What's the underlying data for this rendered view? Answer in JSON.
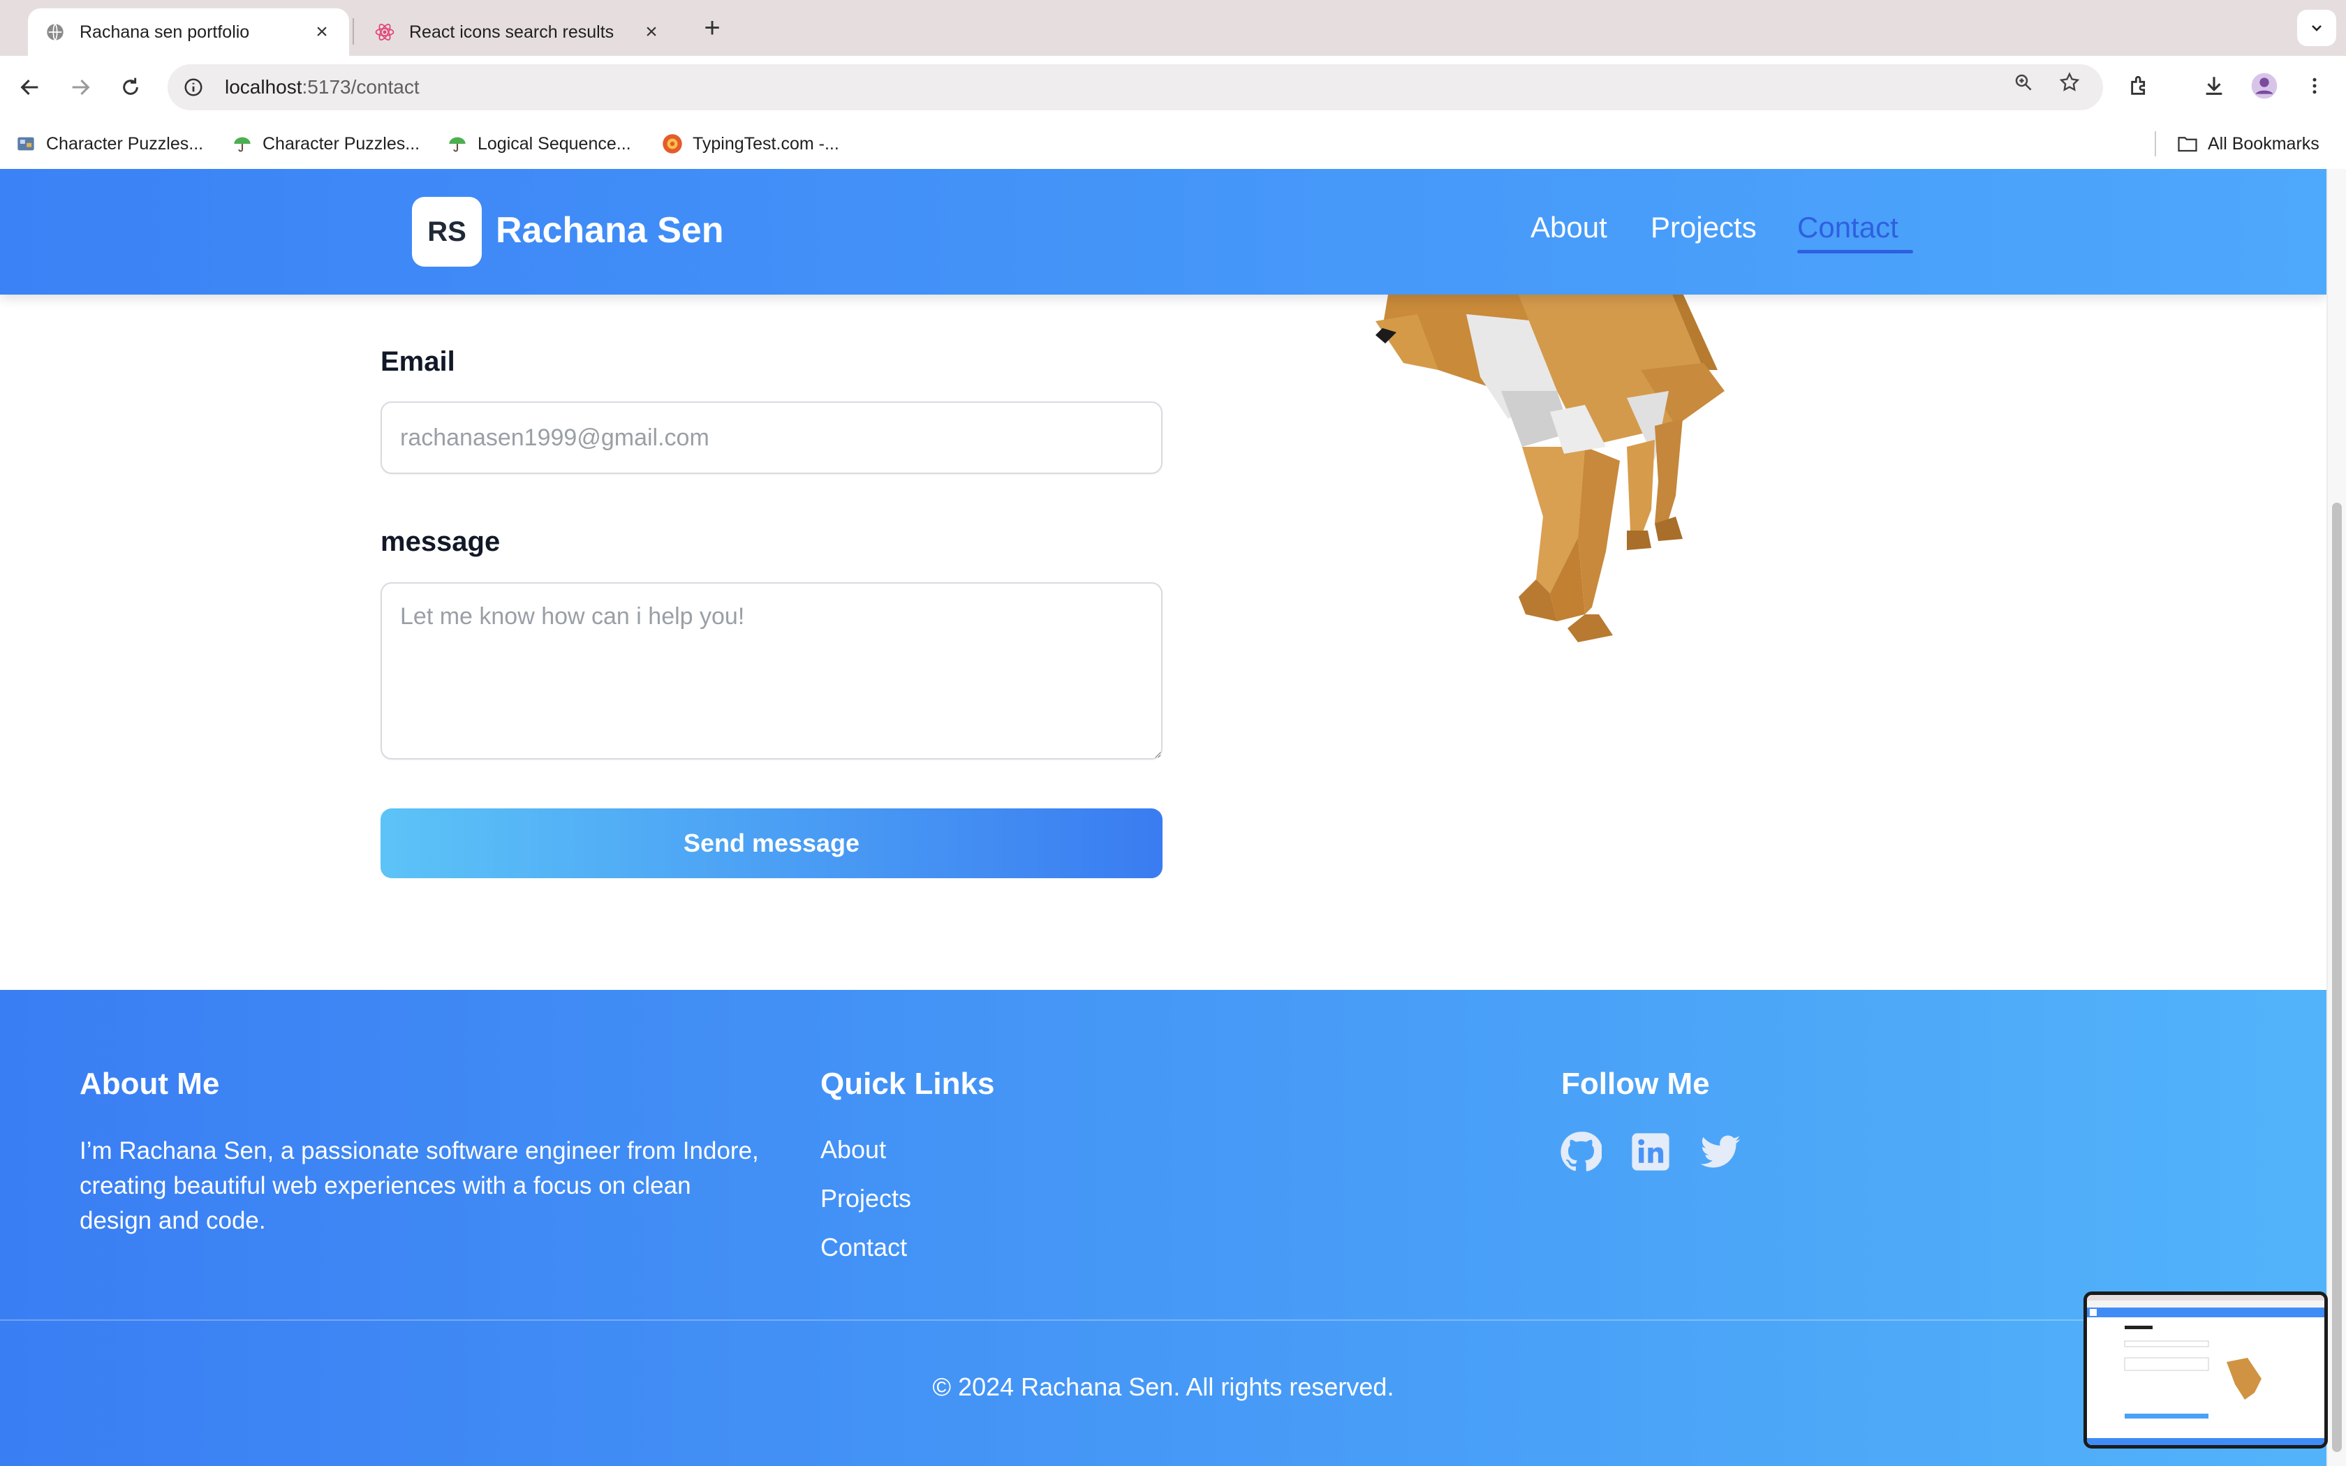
{
  "browser": {
    "tabs": [
      {
        "title": "Rachana sen portfolio",
        "active": true
      },
      {
        "title": "React icons search results",
        "active": false
      }
    ],
    "url_host": "localhost",
    "url_path": ":5173/contact",
    "bookmarks": [
      {
        "label": "Character Puzzles..."
      },
      {
        "label": "Character Puzzles..."
      },
      {
        "label": "Logical Sequence..."
      },
      {
        "label": "TypingTest.com -..."
      }
    ],
    "all_bookmarks_label": "All Bookmarks"
  },
  "header": {
    "logo_initials": "RS",
    "name": "Rachana Sen",
    "nav": [
      {
        "label": "About"
      },
      {
        "label": "Projects"
      },
      {
        "label": "Contact"
      }
    ]
  },
  "form": {
    "email_label": "Email",
    "email_placeholder": "rachanasen1999@gmail.com",
    "message_label": "message",
    "message_placeholder": "Let me know how can i help you!",
    "submit_label": "Send message"
  },
  "footer": {
    "about_title": "About Me",
    "about_text": "I’m Rachana Sen, a passionate software engineer from Indore, creating beautiful web experiences with a focus on clean design and code.",
    "quick_links_title": "Quick Links",
    "quick_links": [
      {
        "label": "About"
      },
      {
        "label": "Projects"
      },
      {
        "label": "Contact"
      }
    ],
    "follow_title": "Follow Me",
    "social": [
      {
        "icon": "github-icon"
      },
      {
        "icon": "linkedin-icon"
      },
      {
        "icon": "twitter-icon"
      }
    ],
    "copyright": "© 2024 Rachana Sen. All rights reserved."
  },
  "colors": {
    "header_gradient_start": "#3b82f6",
    "header_gradient_end": "#4ea8fb",
    "active_nav": "#2f5fe0",
    "button_gradient_start": "#5cc3f7",
    "button_gradient_end": "#3a7cf1"
  }
}
